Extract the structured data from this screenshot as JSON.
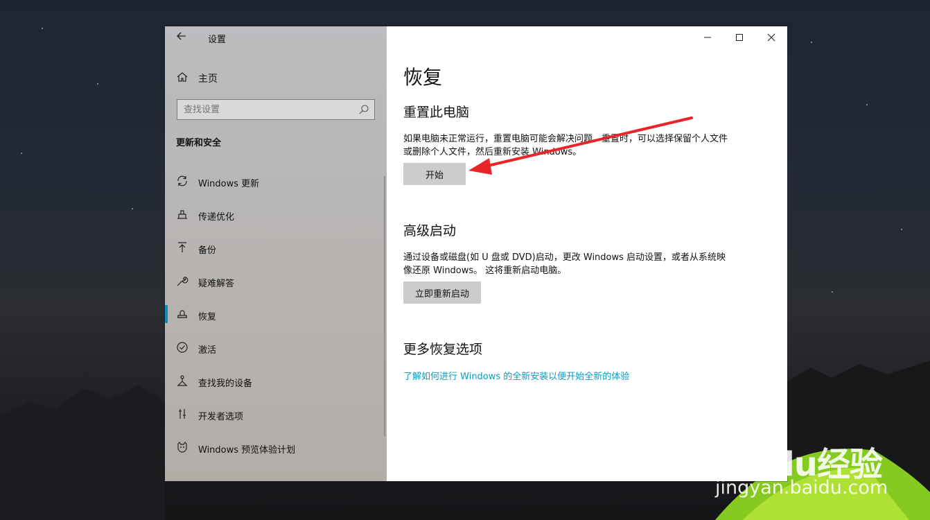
{
  "window": {
    "app_title": "设置",
    "controls": {
      "minimize": "minimize-icon",
      "maximize": "maximize-icon",
      "close": "close-icon"
    }
  },
  "sidebar": {
    "home_label": "主页",
    "search_placeholder": "查找设置",
    "section_title": "更新和安全",
    "items": [
      {
        "label": "Windows 更新",
        "icon": "sync-icon"
      },
      {
        "label": "传递优化",
        "icon": "delivery-optimization-icon"
      },
      {
        "label": "备份",
        "icon": "backup-icon"
      },
      {
        "label": "疑难解答",
        "icon": "wrench-icon"
      },
      {
        "label": "恢复",
        "icon": "recovery-icon",
        "active": true
      },
      {
        "label": "激活",
        "icon": "check-circle-icon"
      },
      {
        "label": "查找我的设备",
        "icon": "find-device-icon"
      },
      {
        "label": "开发者选项",
        "icon": "developer-icon"
      },
      {
        "label": "Windows 预览体验计划",
        "icon": "insider-icon"
      }
    ]
  },
  "main": {
    "title": "恢复",
    "reset": {
      "heading": "重置此电脑",
      "description": "如果电脑未正常运行，重置电脑可能会解决问题。重置时，可以选择保留个人文件或删除个人文件，然后重新安装 Windows。",
      "button": "开始"
    },
    "advanced": {
      "heading": "高级启动",
      "description": "通过设备或磁盘(如 U 盘或 DVD)启动，更改 Windows 启动设置，或者从系统映像还原 Windows。 这将重新启动电脑。",
      "button": "立即重新启动"
    },
    "more": {
      "heading": "更多恢复选项",
      "link": "了解如何进行 Windows 的全新安装以便开始全新的体验"
    }
  },
  "watermark": {
    "brand": "Baidu经验",
    "url": "jingyan.baidu.com"
  },
  "colors": {
    "accent": "#0a9cc0",
    "annotation_arrow": "#e8262a",
    "button_bg": "#cccccc"
  }
}
